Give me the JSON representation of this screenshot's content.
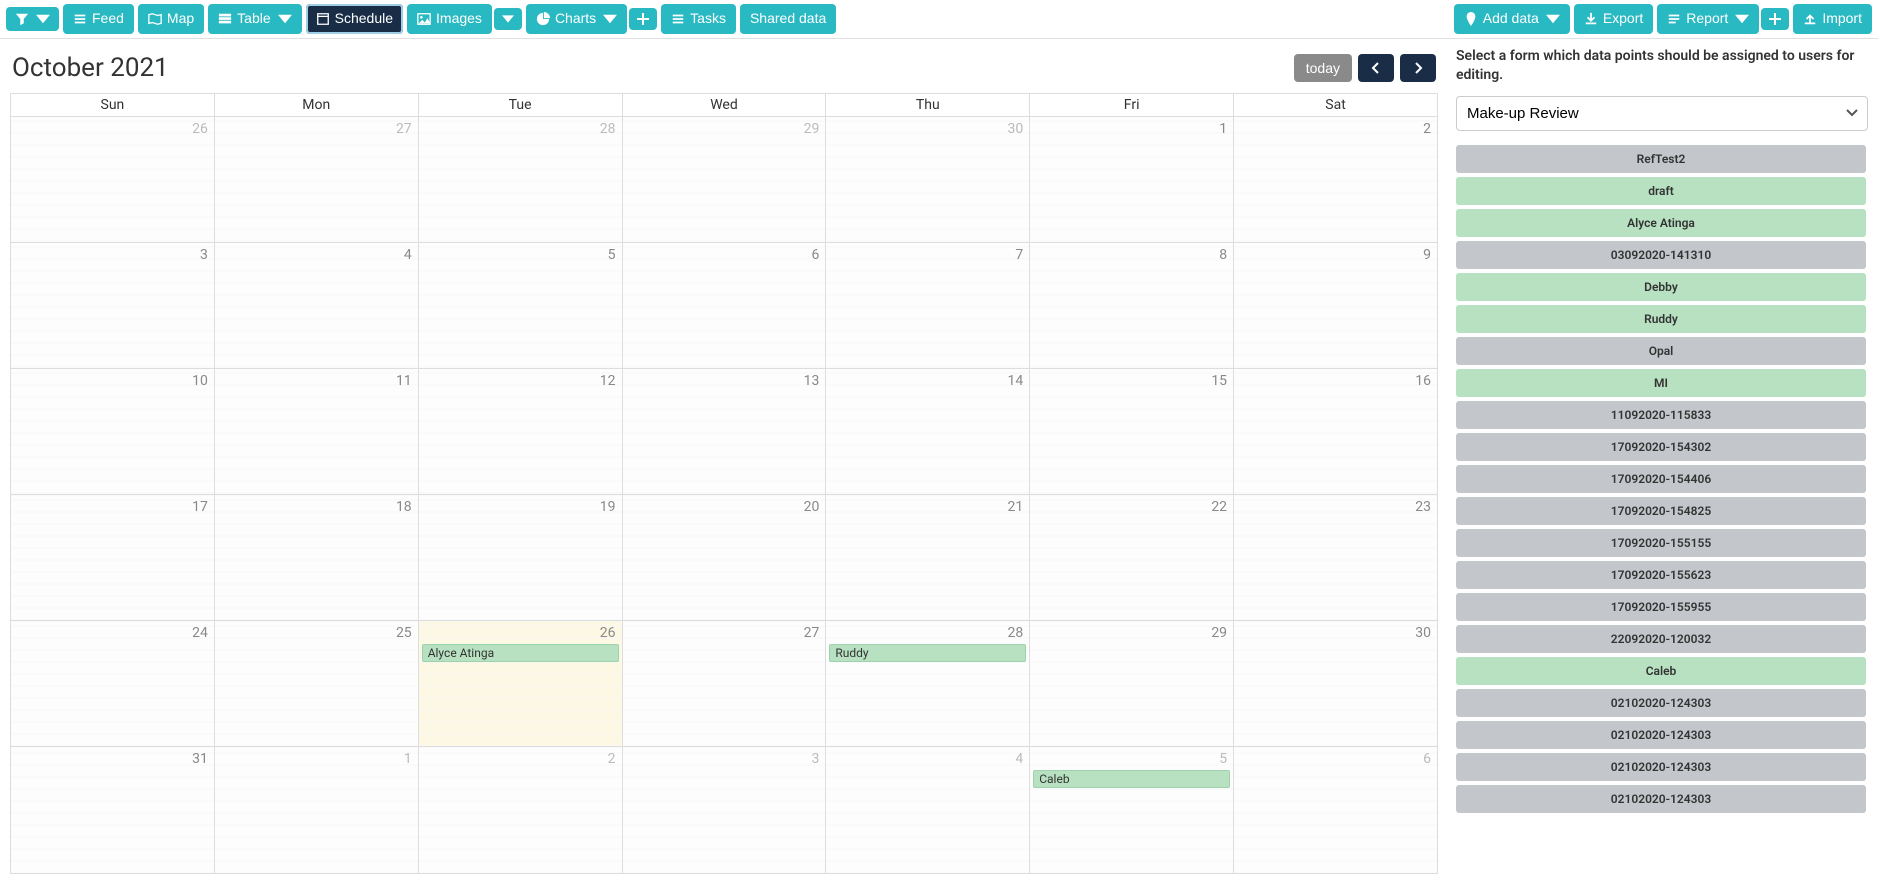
{
  "toolbar": {
    "feed": "Feed",
    "map": "Map",
    "table": "Table",
    "schedule": "Schedule",
    "images": "Images",
    "charts": "Charts",
    "tasks": "Tasks",
    "shared_data": "Shared data",
    "add_data": "Add data",
    "export": "Export",
    "report": "Report",
    "import": "Import"
  },
  "calendar": {
    "title": "October 2021",
    "today_label": "today",
    "day_headers": [
      "Sun",
      "Mon",
      "Tue",
      "Wed",
      "Thu",
      "Fri",
      "Sat"
    ],
    "weeks": [
      [
        {
          "n": "26",
          "other": true
        },
        {
          "n": "27",
          "other": true
        },
        {
          "n": "28",
          "other": true
        },
        {
          "n": "29",
          "other": true
        },
        {
          "n": "30",
          "other": true
        },
        {
          "n": "1"
        },
        {
          "n": "2"
        }
      ],
      [
        {
          "n": "3"
        },
        {
          "n": "4"
        },
        {
          "n": "5"
        },
        {
          "n": "6"
        },
        {
          "n": "7"
        },
        {
          "n": "8"
        },
        {
          "n": "9"
        }
      ],
      [
        {
          "n": "10"
        },
        {
          "n": "11"
        },
        {
          "n": "12"
        },
        {
          "n": "13"
        },
        {
          "n": "14"
        },
        {
          "n": "15"
        },
        {
          "n": "16"
        }
      ],
      [
        {
          "n": "17"
        },
        {
          "n": "18"
        },
        {
          "n": "19"
        },
        {
          "n": "20"
        },
        {
          "n": "21"
        },
        {
          "n": "22"
        },
        {
          "n": "23"
        }
      ],
      [
        {
          "n": "24"
        },
        {
          "n": "25"
        },
        {
          "n": "26",
          "highlight": true,
          "event": "Alyce Atinga"
        },
        {
          "n": "27"
        },
        {
          "n": "28",
          "event": "Ruddy"
        },
        {
          "n": "29"
        },
        {
          "n": "30"
        }
      ],
      [
        {
          "n": "31"
        },
        {
          "n": "1",
          "other": true
        },
        {
          "n": "2",
          "other": true
        },
        {
          "n": "3",
          "other": true
        },
        {
          "n": "4",
          "other": true
        },
        {
          "n": "5",
          "other": true,
          "event": "Caleb"
        },
        {
          "n": "6",
          "other": true
        }
      ]
    ]
  },
  "side": {
    "prompt": "Select a form which data points should be assigned to users for editing.",
    "select_value": "Make-up Review",
    "datapoints": [
      {
        "label": "RefTest2",
        "tone": "gray"
      },
      {
        "label": "draft",
        "tone": "green"
      },
      {
        "label": "Alyce Atinga",
        "tone": "green"
      },
      {
        "label": "03092020-141310",
        "tone": "gray"
      },
      {
        "label": "Debby",
        "tone": "green"
      },
      {
        "label": "Ruddy",
        "tone": "green"
      },
      {
        "label": "Opal",
        "tone": "gray"
      },
      {
        "label": "MI",
        "tone": "green"
      },
      {
        "label": "11092020-115833",
        "tone": "gray"
      },
      {
        "label": "17092020-154302",
        "tone": "gray"
      },
      {
        "label": "17092020-154406",
        "tone": "gray"
      },
      {
        "label": "17092020-154825",
        "tone": "gray"
      },
      {
        "label": "17092020-155155",
        "tone": "gray"
      },
      {
        "label": "17092020-155623",
        "tone": "gray"
      },
      {
        "label": "17092020-155955",
        "tone": "gray"
      },
      {
        "label": "22092020-120032",
        "tone": "gray"
      },
      {
        "label": "Caleb",
        "tone": "green"
      },
      {
        "label": "02102020-124303",
        "tone": "gray"
      },
      {
        "label": "02102020-124303",
        "tone": "gray"
      },
      {
        "label": "02102020-124303",
        "tone": "gray"
      },
      {
        "label": "02102020-124303",
        "tone": "gray"
      }
    ]
  }
}
